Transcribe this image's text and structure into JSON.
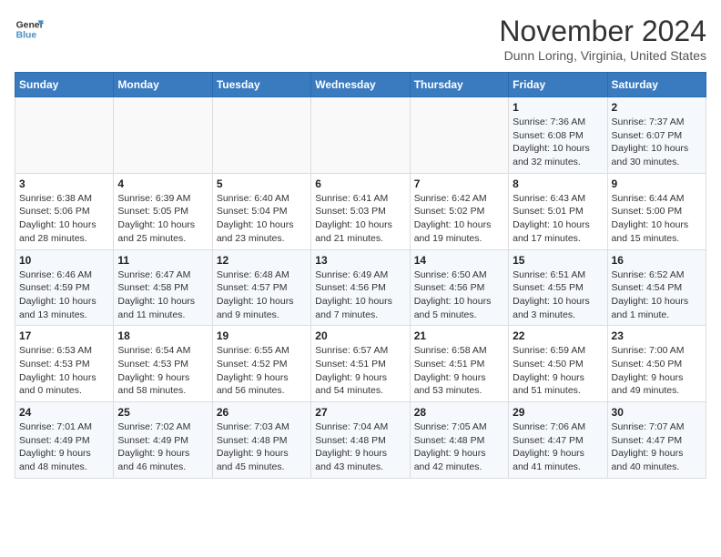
{
  "header": {
    "logo_line1": "General",
    "logo_line2": "Blue",
    "month_title": "November 2024",
    "location": "Dunn Loring, Virginia, United States"
  },
  "days_of_week": [
    "Sunday",
    "Monday",
    "Tuesday",
    "Wednesday",
    "Thursday",
    "Friday",
    "Saturday"
  ],
  "weeks": [
    [
      {
        "day": "",
        "detail": ""
      },
      {
        "day": "",
        "detail": ""
      },
      {
        "day": "",
        "detail": ""
      },
      {
        "day": "",
        "detail": ""
      },
      {
        "day": "",
        "detail": ""
      },
      {
        "day": "1",
        "detail": "Sunrise: 7:36 AM\nSunset: 6:08 PM\nDaylight: 10 hours\nand 32 minutes."
      },
      {
        "day": "2",
        "detail": "Sunrise: 7:37 AM\nSunset: 6:07 PM\nDaylight: 10 hours\nand 30 minutes."
      }
    ],
    [
      {
        "day": "3",
        "detail": "Sunrise: 6:38 AM\nSunset: 5:06 PM\nDaylight: 10 hours\nand 28 minutes."
      },
      {
        "day": "4",
        "detail": "Sunrise: 6:39 AM\nSunset: 5:05 PM\nDaylight: 10 hours\nand 25 minutes."
      },
      {
        "day": "5",
        "detail": "Sunrise: 6:40 AM\nSunset: 5:04 PM\nDaylight: 10 hours\nand 23 minutes."
      },
      {
        "day": "6",
        "detail": "Sunrise: 6:41 AM\nSunset: 5:03 PM\nDaylight: 10 hours\nand 21 minutes."
      },
      {
        "day": "7",
        "detail": "Sunrise: 6:42 AM\nSunset: 5:02 PM\nDaylight: 10 hours\nand 19 minutes."
      },
      {
        "day": "8",
        "detail": "Sunrise: 6:43 AM\nSunset: 5:01 PM\nDaylight: 10 hours\nand 17 minutes."
      },
      {
        "day": "9",
        "detail": "Sunrise: 6:44 AM\nSunset: 5:00 PM\nDaylight: 10 hours\nand 15 minutes."
      }
    ],
    [
      {
        "day": "10",
        "detail": "Sunrise: 6:46 AM\nSunset: 4:59 PM\nDaylight: 10 hours\nand 13 minutes."
      },
      {
        "day": "11",
        "detail": "Sunrise: 6:47 AM\nSunset: 4:58 PM\nDaylight: 10 hours\nand 11 minutes."
      },
      {
        "day": "12",
        "detail": "Sunrise: 6:48 AM\nSunset: 4:57 PM\nDaylight: 10 hours\nand 9 minutes."
      },
      {
        "day": "13",
        "detail": "Sunrise: 6:49 AM\nSunset: 4:56 PM\nDaylight: 10 hours\nand 7 minutes."
      },
      {
        "day": "14",
        "detail": "Sunrise: 6:50 AM\nSunset: 4:56 PM\nDaylight: 10 hours\nand 5 minutes."
      },
      {
        "day": "15",
        "detail": "Sunrise: 6:51 AM\nSunset: 4:55 PM\nDaylight: 10 hours\nand 3 minutes."
      },
      {
        "day": "16",
        "detail": "Sunrise: 6:52 AM\nSunset: 4:54 PM\nDaylight: 10 hours\nand 1 minute."
      }
    ],
    [
      {
        "day": "17",
        "detail": "Sunrise: 6:53 AM\nSunset: 4:53 PM\nDaylight: 10 hours\nand 0 minutes."
      },
      {
        "day": "18",
        "detail": "Sunrise: 6:54 AM\nSunset: 4:53 PM\nDaylight: 9 hours\nand 58 minutes."
      },
      {
        "day": "19",
        "detail": "Sunrise: 6:55 AM\nSunset: 4:52 PM\nDaylight: 9 hours\nand 56 minutes."
      },
      {
        "day": "20",
        "detail": "Sunrise: 6:57 AM\nSunset: 4:51 PM\nDaylight: 9 hours\nand 54 minutes."
      },
      {
        "day": "21",
        "detail": "Sunrise: 6:58 AM\nSunset: 4:51 PM\nDaylight: 9 hours\nand 53 minutes."
      },
      {
        "day": "22",
        "detail": "Sunrise: 6:59 AM\nSunset: 4:50 PM\nDaylight: 9 hours\nand 51 minutes."
      },
      {
        "day": "23",
        "detail": "Sunrise: 7:00 AM\nSunset: 4:50 PM\nDaylight: 9 hours\nand 49 minutes."
      }
    ],
    [
      {
        "day": "24",
        "detail": "Sunrise: 7:01 AM\nSunset: 4:49 PM\nDaylight: 9 hours\nand 48 minutes."
      },
      {
        "day": "25",
        "detail": "Sunrise: 7:02 AM\nSunset: 4:49 PM\nDaylight: 9 hours\nand 46 minutes."
      },
      {
        "day": "26",
        "detail": "Sunrise: 7:03 AM\nSunset: 4:48 PM\nDaylight: 9 hours\nand 45 minutes."
      },
      {
        "day": "27",
        "detail": "Sunrise: 7:04 AM\nSunset: 4:48 PM\nDaylight: 9 hours\nand 43 minutes."
      },
      {
        "day": "28",
        "detail": "Sunrise: 7:05 AM\nSunset: 4:48 PM\nDaylight: 9 hours\nand 42 minutes."
      },
      {
        "day": "29",
        "detail": "Sunrise: 7:06 AM\nSunset: 4:47 PM\nDaylight: 9 hours\nand 41 minutes."
      },
      {
        "day": "30",
        "detail": "Sunrise: 7:07 AM\nSunset: 4:47 PM\nDaylight: 9 hours\nand 40 minutes."
      }
    ]
  ]
}
